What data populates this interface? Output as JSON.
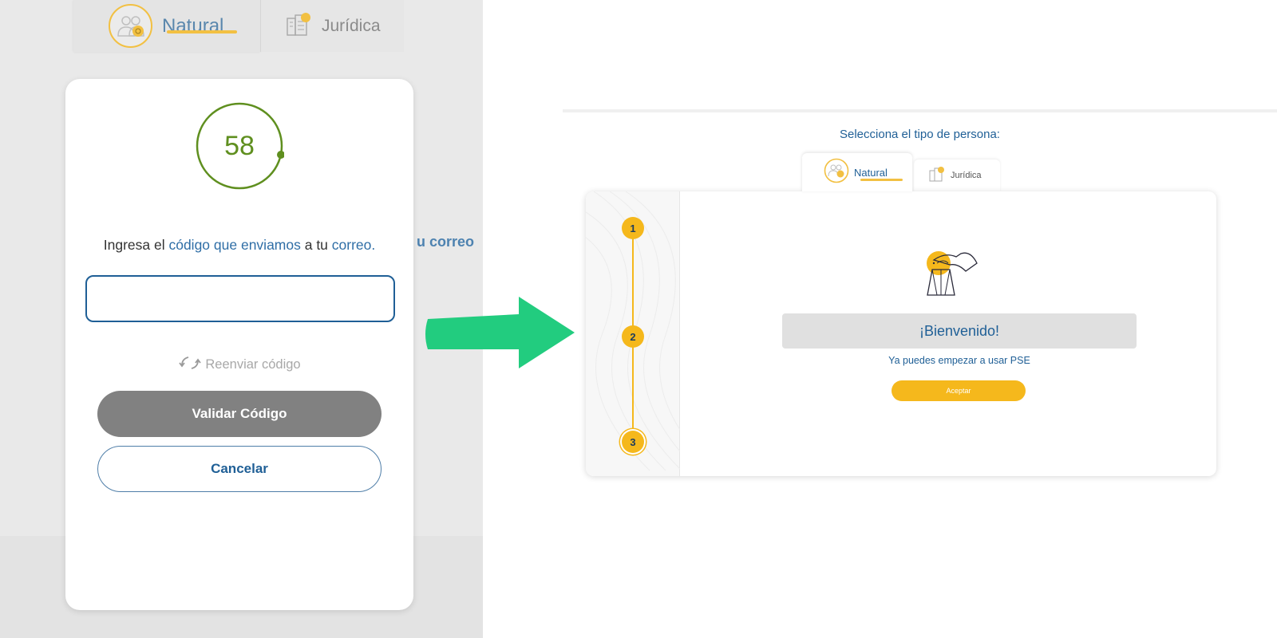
{
  "left": {
    "tabs": [
      {
        "label": "Natural",
        "icon": "people-icon",
        "active": true
      },
      {
        "label": "Jurídica",
        "icon": "building-icon",
        "active": false
      }
    ],
    "background_text": "u correo",
    "modal": {
      "timer_value": "58",
      "prompt": {
        "part1": "Ingresa el ",
        "highlight1": "código que enviamos",
        "part2": " a tu ",
        "highlight2": "correo."
      },
      "code_input_value": "",
      "resend_label": "Reenviar código",
      "validate_label": "Validar Código",
      "cancel_label": "Cancelar"
    }
  },
  "arrow_icon": "right-arrow-icon",
  "right": {
    "select_title": "Selecciona el tipo de persona:",
    "tabs": [
      {
        "label": "Natural",
        "icon": "people-icon",
        "active": true
      },
      {
        "label": "Jurídica",
        "icon": "building-icon",
        "active": false
      }
    ],
    "steps": [
      "1",
      "2",
      "3"
    ],
    "current_step": "3",
    "welcome_title": "¡Bienvenido!",
    "welcome_subtitle": "Ya puedes empezar a usar PSE",
    "accept_label": "Aceptar"
  },
  "colors": {
    "primary_blue": "#1f5f96",
    "accent_yellow": "#f5b81c",
    "arrow_green": "#22cc7f",
    "timer_green": "#5f8f1f",
    "disabled_gray": "#818181"
  }
}
